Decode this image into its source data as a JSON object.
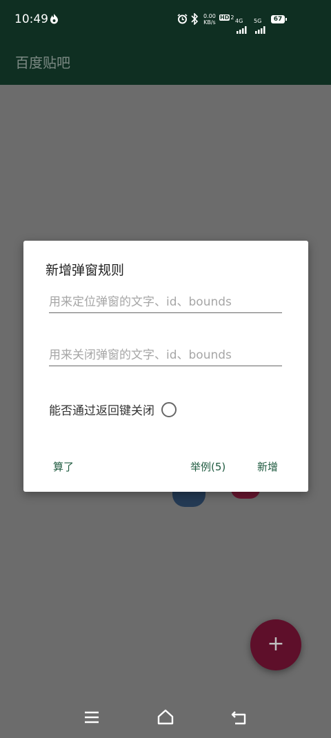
{
  "status_bar": {
    "time": "10:49",
    "net_speed_top": "0.00",
    "net_speed_unit": "KB/s",
    "hd_badge": "HD",
    "hd_sub": "2",
    "signal1_label": "4G",
    "signal2_label": "5G",
    "battery": "67"
  },
  "app_bar": {
    "title": "百度贴吧"
  },
  "dialog": {
    "title": "新增弹窗规则",
    "locate_placeholder": "用来定位弹窗的文字、id、bounds",
    "close_placeholder": "用来关闭弹窗的文字、id、bounds",
    "back_key_label": "能否通过返回键关闭",
    "cancel_label": "算了",
    "example_label": "举例(5)",
    "add_label": "新增"
  },
  "fab": {
    "symbol": "+"
  },
  "colors": {
    "app_bar_bg": "#0f2f22",
    "scrim": "#6c6c6c",
    "button_text": "#1e5a3f",
    "fab_bg": "#5e0f2a"
  },
  "icons": {
    "flame": "flame-icon",
    "alarm": "alarm-icon",
    "bluetooth": "bluetooth-icon",
    "menu": "menu-icon",
    "home": "home-icon",
    "back": "back-icon"
  }
}
